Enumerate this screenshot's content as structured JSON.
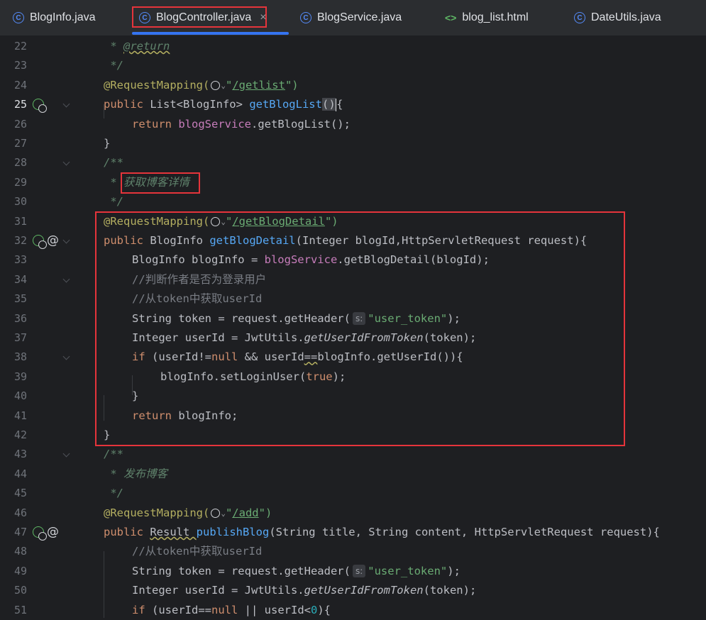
{
  "tabs": [
    {
      "label": "BlogInfo.java",
      "icon": "class-icon"
    },
    {
      "label": "BlogController.java",
      "icon": "class-icon",
      "active": true
    },
    {
      "label": "BlogService.java",
      "icon": "class-icon"
    },
    {
      "label": "blog_list.html",
      "icon": "html-icon"
    },
    {
      "label": "DateUtils.java",
      "icon": "class-icon"
    }
  ],
  "tab_close": "×",
  "hint_s": "s:",
  "lines": {
    "22": {
      "num": "22",
      "t1": " * ",
      "t2": "@return"
    },
    "23": {
      "num": "23",
      "t1": " */"
    },
    "24": {
      "num": "24",
      "t1": "@RequestMapping(",
      "t2": "\"",
      "t3": "/getlist",
      "t4": "\")"
    },
    "25": {
      "num": "25",
      "t1": "public ",
      "t2": "List<BlogInfo> ",
      "t3": "getBlogList",
      "t4": "(",
      "t5": ")",
      "t6": "{"
    },
    "26": {
      "num": "26",
      "t1": "return ",
      "t2": "blogService",
      ".": ".",
      "t3": "getBlogList();"
    },
    "27": {
      "num": "27",
      "t1": "}"
    },
    "28": {
      "num": "28",
      "t1": "/**"
    },
    "29": {
      "num": "29",
      "t1": " * ",
      "t2": "获取博客详情"
    },
    "30": {
      "num": "30",
      "t1": " */"
    },
    "31": {
      "num": "31",
      "t1": "@RequestMapping(",
      "t2": "\"",
      "t3": "/getBlogDetail",
      "t4": "\")"
    },
    "32": {
      "num": "32",
      "t1": "public ",
      "t2": "BlogInfo ",
      "t3": "getBlogDetail",
      "t4": "(Integer blogId,HttpServletRequest request){"
    },
    "33": {
      "num": "33",
      "t1": "BlogInfo blogInfo = ",
      "t2": "blogService",
      "t3": ".getBlogDetail(blogId);"
    },
    "34": {
      "num": "34",
      "t1": "//判断作者是否为登录用户"
    },
    "35": {
      "num": "35",
      "t1": "//从token中获取userId"
    },
    "36": {
      "num": "36",
      "t1": "String token = request.getHeader(",
      "t2": "\"user_token\"",
      "t3": ");"
    },
    "37": {
      "num": "37",
      "t1": "Integer userId = JwtUtils.",
      "t2": "getUserIdFromToken",
      "t3": "(token);"
    },
    "38": {
      "num": "38",
      "t1": "if ",
      "t2": "(userId!=",
      "t3": "null ",
      "t4": "&& userId",
      "t5": "==",
      "t6": "blogInfo.getUserId()){"
    },
    "39": {
      "num": "39",
      "t1": "blogInfo.setLoginUser(",
      "t2": "true",
      "t3": ");"
    },
    "40": {
      "num": "40",
      "t1": "}"
    },
    "41": {
      "num": "41",
      "t1": "return ",
      "t2": "blogInfo;"
    },
    "42": {
      "num": "42",
      "t1": "}"
    },
    "43": {
      "num": "43",
      "t1": "/**"
    },
    "44": {
      "num": "44",
      "t1": " * ",
      "t2": "发布博客"
    },
    "45": {
      "num": "45",
      "t1": " */"
    },
    "46": {
      "num": "46",
      "t1": "@RequestMapping(",
      "t2": "\"",
      "t3": "/add",
      "t4": "\")"
    },
    "47": {
      "num": "47",
      "t1": "public ",
      "t2": "Result ",
      "t3": "publishBlog",
      "t4": "(String title, String content, HttpServletRequest request){"
    },
    "48": {
      "num": "48",
      "t1": "//从token中获取userId"
    },
    "49": {
      "num": "49",
      "t1": "String token = request.getHeader(",
      "t2": "\"user_token\"",
      "t3": ");"
    },
    "50": {
      "num": "50",
      "t1": "Integer userId = JwtUtils.",
      "t2": "getUserIdFromToken",
      "t3": "(token);"
    },
    "51": {
      "num": "51",
      "t1": "if ",
      "t2": "(userId==",
      "t3": "null ",
      "t4": "|| userId<",
      "t5": "0",
      "t6": "){"
    }
  },
  "colors": {
    "highlight_box": "#e5343b",
    "active_tab_underline": "#3574f0"
  }
}
